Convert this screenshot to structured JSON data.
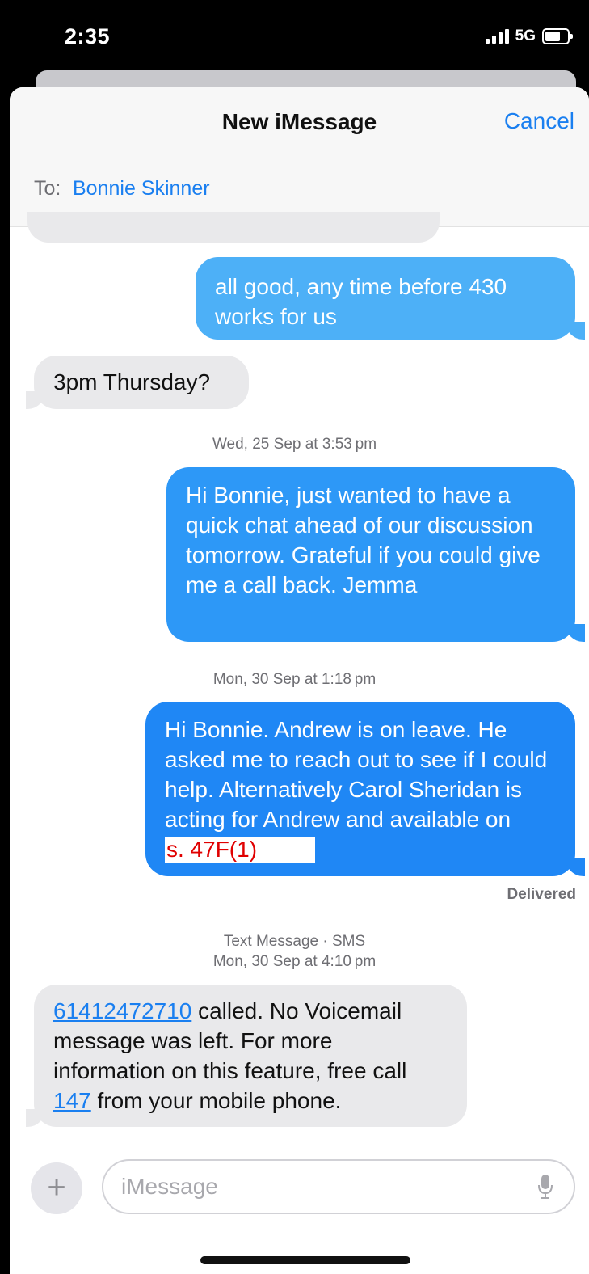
{
  "status": {
    "time": "2:35",
    "network": "5G"
  },
  "header": {
    "title": "New iMessage",
    "cancel_label": "Cancel"
  },
  "recipient": {
    "to_label": "To:",
    "name": "Bonnie Skinner"
  },
  "colors": {
    "outgoing_light": "#4db0f7",
    "outgoing_dark": "#1f87f5",
    "incoming": "#e9e9eb",
    "link": "#1a7ff0"
  },
  "messages": {
    "m1": {
      "text": "all good, any time before 430 works for us"
    },
    "m2": {
      "text": "3pm Thursday?"
    },
    "stamp1": "Wed, 25 Sep at 3:53 pm",
    "m3": {
      "text": "Hi Bonnie, just wanted to have a quick chat ahead of our discussion tomorrow. Grateful if you could give me a call back. Jemma"
    },
    "stamp2": "Mon, 30 Sep at 1:18 pm",
    "m4": {
      "text": "Hi Bonnie. Andrew is on leave. He asked me to reach out to see if I could help. Alternatively Carol Sheridan is acting for Andrew and available on",
      "redaction": "s. 47F(1)"
    },
    "delivered": "Delivered",
    "stamp3_line1": "Text Message · SMS",
    "stamp3_line2": "Mon, 30 Sep at 4:10 pm",
    "m5": {
      "number": "61412472710",
      "part1": " called. No Voicemail message was left. For more information on this feature, free call ",
      "short_number": "147",
      "part2": " from your mobile phone."
    }
  },
  "composer": {
    "placeholder": "iMessage",
    "plus_icon": "plus-icon",
    "mic_icon": "microphone-icon"
  }
}
